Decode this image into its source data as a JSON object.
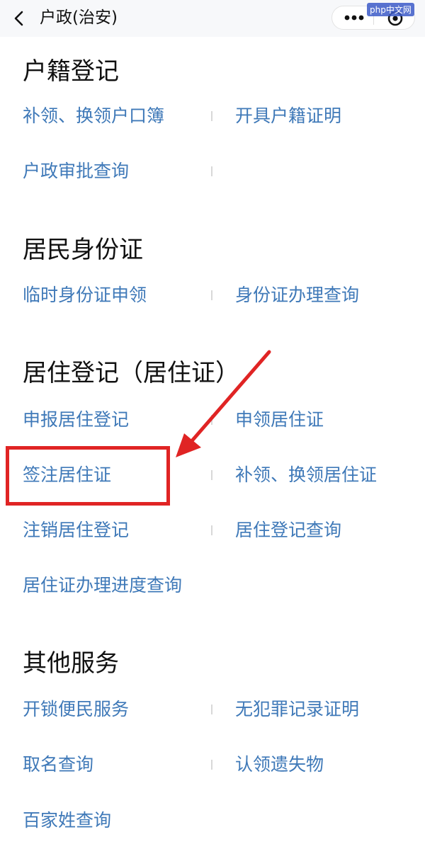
{
  "header": {
    "title": "户政(治安)",
    "watermark": "php中文网"
  },
  "sections": [
    {
      "title": "户籍登记",
      "items": [
        "补领、换领户口簿",
        "开具户籍证明",
        "户政审批查询"
      ]
    },
    {
      "title": "居民身份证",
      "items": [
        "临时身份证申领",
        "身份证办理查询"
      ]
    },
    {
      "title": "居住登记（居住证）",
      "items": [
        "申报居住登记",
        "申领居住证",
        "签注居住证",
        "补领、换领居住证",
        "注销居住登记",
        "居住登记查询",
        "居住证办理进度查询"
      ]
    },
    {
      "title": "其他服务",
      "items": [
        "开锁便民服务",
        "无犯罪记录证明",
        "取名查询",
        "认领遗失物",
        "百家姓查询"
      ]
    }
  ],
  "annotation": {
    "highlighted_item": "签注居住证",
    "color": "#e02424"
  },
  "colors": {
    "link": "#3f79b8",
    "title": "#111111",
    "header_bg": "#f7f8fa"
  }
}
